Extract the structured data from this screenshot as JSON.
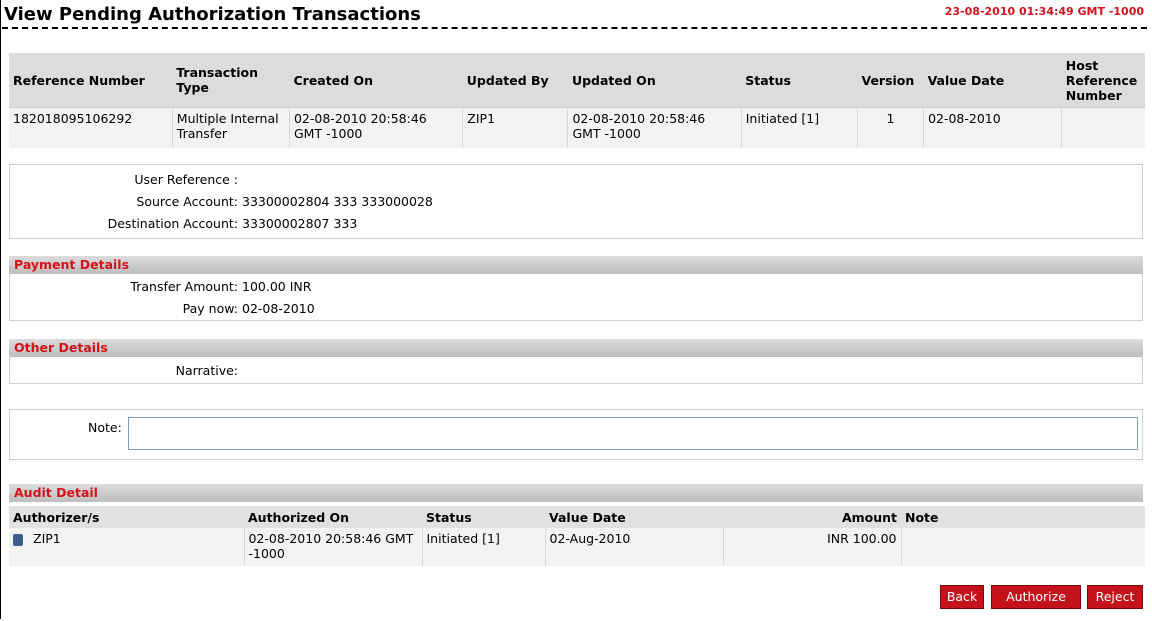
{
  "header": {
    "title": "View Pending Authorization Transactions",
    "timestamp": "23-08-2010 01:34:49 GMT -1000"
  },
  "transaction": {
    "columns": [
      "Reference Number",
      "Transaction Type",
      "Created On",
      "Updated By",
      "Updated On",
      "Status",
      "Version",
      "Value Date",
      "Host Reference Number"
    ],
    "row": {
      "reference_number": "182018095106292",
      "transaction_type": "Multiple Internal Transfer",
      "created_on": "02-08-2010 20:58:46 GMT -1000",
      "updated_by": "ZIP1",
      "updated_on": "02-08-2010 20:58:46 GMT -1000",
      "status": "Initiated [1]",
      "version": "1",
      "value_date": "02-08-2010",
      "host_reference_number": ""
    }
  },
  "accounts": {
    "user_reference_label": "User Reference :",
    "user_reference_value": "",
    "source_label": "Source Account:",
    "source_value": "33300002804 333 333000028",
    "destination_label": "Destination Account:",
    "destination_value": "33300002807 333"
  },
  "payment": {
    "heading": "Payment Details",
    "amount_label": "Transfer Amount:",
    "amount_value": "100.00  INR",
    "paynow_label": "Pay now:",
    "paynow_value": "02-08-2010"
  },
  "other": {
    "heading": "Other Details",
    "narrative_label": "Narrative:",
    "narrative_value": ""
  },
  "note": {
    "label": "Note:",
    "value": ""
  },
  "audit": {
    "heading": "Audit Detail",
    "columns": [
      "Authorizer/s",
      "Authorized On",
      "Status",
      "Value Date",
      "Amount",
      "Note"
    ],
    "row": {
      "authorizer": "ZIP1",
      "authorized_on": "02-08-2010 20:58:46 GMT -1000",
      "status": "Initiated [1]",
      "value_date": "02-Aug-2010",
      "amount": "INR  100.00",
      "note": ""
    }
  },
  "buttons": {
    "back": "Back",
    "authorize": "Authorize",
    "reject": "Reject"
  },
  "colors": {
    "accent": "#d3121b",
    "button": "#c4121a"
  }
}
